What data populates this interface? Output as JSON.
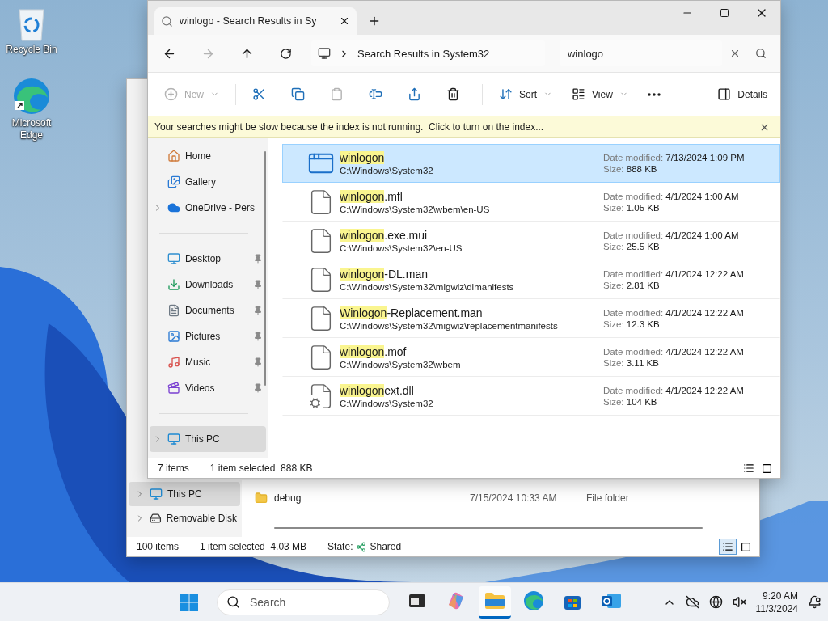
{
  "desktop_icons": [
    {
      "kind": "recycle",
      "label": "Recycle Bin"
    },
    {
      "kind": "edge",
      "label": "Microsoft Edge"
    }
  ],
  "back_window": {
    "nav": [
      {
        "kind": "pc",
        "label": "This PC",
        "selected": true,
        "expandable": true
      },
      {
        "kind": "disk",
        "label": "Removable Disk",
        "selected": false,
        "expandable": true
      }
    ],
    "rows": [
      {
        "name": "debug",
        "date": "7/15/2024 10:33 AM",
        "type": "File folder"
      }
    ],
    "status": {
      "count": "100 items",
      "selection": "1 item selected  4.03 MB",
      "state_label": "State:",
      "state_value": "Shared"
    },
    "views": [
      {
        "kind": "details",
        "selected": true
      },
      {
        "kind": "tiles",
        "selected": false
      }
    ]
  },
  "window": {
    "tab_title": "winlogo - Search Results in Sy",
    "address": "Search Results in System32",
    "search_value": "winlogo",
    "nav_buttons": [
      {
        "kind": "back",
        "disabled": false
      },
      {
        "kind": "forward",
        "disabled": true
      },
      {
        "kind": "up",
        "disabled": false
      },
      {
        "kind": "refresh",
        "disabled": false
      }
    ],
    "command_groups": [
      [
        {
          "kind": "new",
          "label": "New",
          "disabled": true
        }
      ],
      [
        {
          "kind": "cut",
          "disabled": false
        },
        {
          "kind": "copy",
          "disabled": false
        },
        {
          "kind": "paste",
          "disabled": true
        },
        {
          "kind": "rename",
          "disabled": false
        },
        {
          "kind": "share",
          "disabled": false
        },
        {
          "kind": "delete",
          "disabled": false
        }
      ],
      [
        {
          "kind": "sort",
          "label": "Sort",
          "disabled": false
        },
        {
          "kind": "view",
          "label": "View",
          "disabled": false
        },
        {
          "kind": "more",
          "disabled": false
        }
      ]
    ],
    "details_label": "Details",
    "info_bar": "Your searches might be slow because the index is not running.  Click to turn on the index...",
    "nav_groups": [
      [
        {
          "kind": "home",
          "label": "Home",
          "selected": false,
          "expandable": false,
          "pinned": false
        },
        {
          "kind": "gallery",
          "label": "Gallery",
          "selected": false,
          "expandable": false,
          "pinned": false
        },
        {
          "kind": "onedrive",
          "label": "OneDrive - Pers",
          "selected": false,
          "expandable": true,
          "pinned": false
        }
      ],
      [
        {
          "kind": "desktop",
          "label": "Desktop",
          "selected": false,
          "expandable": false,
          "pinned": true
        },
        {
          "kind": "downloads",
          "label": "Downloads",
          "selected": false,
          "expandable": false,
          "pinned": true
        },
        {
          "kind": "documents",
          "label": "Documents",
          "selected": false,
          "expandable": false,
          "pinned": true
        },
        {
          "kind": "pictures",
          "label": "Pictures",
          "selected": false,
          "expandable": false,
          "pinned": true
        },
        {
          "kind": "music",
          "label": "Music",
          "selected": false,
          "expandable": false,
          "pinned": true
        },
        {
          "kind": "videos",
          "label": "Videos",
          "selected": false,
          "expandable": false,
          "pinned": true
        }
      ],
      [
        {
          "kind": "pc",
          "label": "This PC",
          "selected": true,
          "expandable": true,
          "pinned": false
        }
      ]
    ],
    "results": [
      {
        "kind": "app",
        "selected": true,
        "match": "winlogon",
        "path": "C:\\Windows\\System32",
        "date_label": "Date modified:",
        "date": "7/13/2024 1:09 PM",
        "size_label": "Size:",
        "size": "888 KB"
      },
      {
        "kind": "file",
        "selected": false,
        "match": "winlogon",
        "rest": ".mfl",
        "path": "C:\\Windows\\System32\\wbem\\en-US",
        "date_label": "Date modified:",
        "date": "4/1/2024 1:00 AM",
        "size_label": "Size:",
        "size": "1.05 KB"
      },
      {
        "kind": "file",
        "selected": false,
        "match": "winlogon",
        "rest": ".exe.mui",
        "path": "C:\\Windows\\System32\\en-US",
        "date_label": "Date modified:",
        "date": "4/1/2024 1:00 AM",
        "size_label": "Size:",
        "size": "25.5 KB"
      },
      {
        "kind": "file",
        "selected": false,
        "match": "winlogon",
        "rest": "-DL.man",
        "path": "C:\\Windows\\System32\\migwiz\\dlmanifests",
        "date_label": "Date modified:",
        "date": "4/1/2024 12:22 AM",
        "size_label": "Size:",
        "size": "2.81 KB"
      },
      {
        "kind": "file",
        "selected": false,
        "match": "Winlogon",
        "rest": "-Replacement.man",
        "path": "C:\\Windows\\System32\\migwiz\\replacementmanifests",
        "date_label": "Date modified:",
        "date": "4/1/2024 12:22 AM",
        "size_label": "Size:",
        "size": "12.3 KB"
      },
      {
        "kind": "file",
        "selected": false,
        "match": "winlogon",
        "rest": ".mof",
        "path": "C:\\Windows\\System32\\wbem",
        "date_label": "Date modified:",
        "date": "4/1/2024 12:22 AM",
        "size_label": "Size:",
        "size": "3.11 KB"
      },
      {
        "kind": "dll",
        "selected": false,
        "match": "winlogon",
        "rest": "ext.dll",
        "path": "C:\\Windows\\System32",
        "date_label": "Date modified:",
        "date": "4/1/2024 12:22 AM",
        "size_label": "Size:",
        "size": "104 KB"
      }
    ],
    "status": {
      "count": "7 items",
      "selection": "1 item selected  888 KB"
    },
    "views": [
      {
        "kind": "details",
        "selected": false
      },
      {
        "kind": "tiles",
        "selected": false
      }
    ]
  },
  "taskbar": {
    "search_placeholder": "Search",
    "apps": [
      {
        "kind": "taskview",
        "active": false
      },
      {
        "kind": "copilot",
        "active": false
      },
      {
        "kind": "explorer",
        "active": true
      },
      {
        "kind": "edge",
        "active": false
      },
      {
        "kind": "store",
        "active": false
      },
      {
        "kind": "outlook",
        "active": false
      }
    ],
    "time": "9:20 AM",
    "date": "11/3/2024"
  }
}
